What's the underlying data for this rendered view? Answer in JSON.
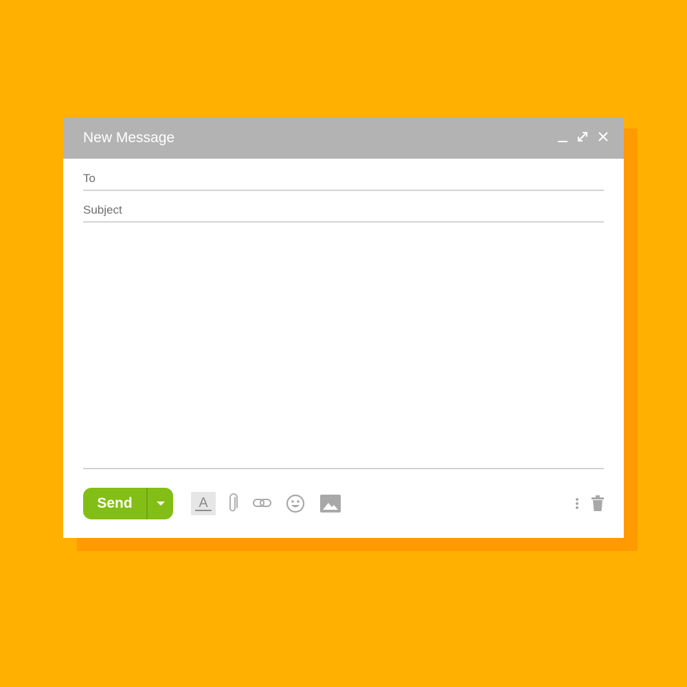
{
  "window": {
    "title": "New Message"
  },
  "fields": {
    "to_label": "To",
    "subject_label": "Subject",
    "to_value": "",
    "subject_value": "",
    "body_value": ""
  },
  "footer": {
    "send_label": "Send"
  },
  "icons": {
    "minimize": "minimize-icon",
    "expand": "expand-icon",
    "close": "close-icon",
    "formatting": "text-format-icon",
    "attach": "paperclip-icon",
    "link": "link-icon",
    "emoji": "emoji-icon",
    "image": "image-icon",
    "more": "more-vertical-icon",
    "discard": "trash-icon"
  },
  "colors": {
    "background": "#FFB000",
    "shadow": "#FF9A00",
    "titlebar": "#B3B3B3",
    "send_button": "#82BE16",
    "icon_gray": "#A8A8A8"
  }
}
